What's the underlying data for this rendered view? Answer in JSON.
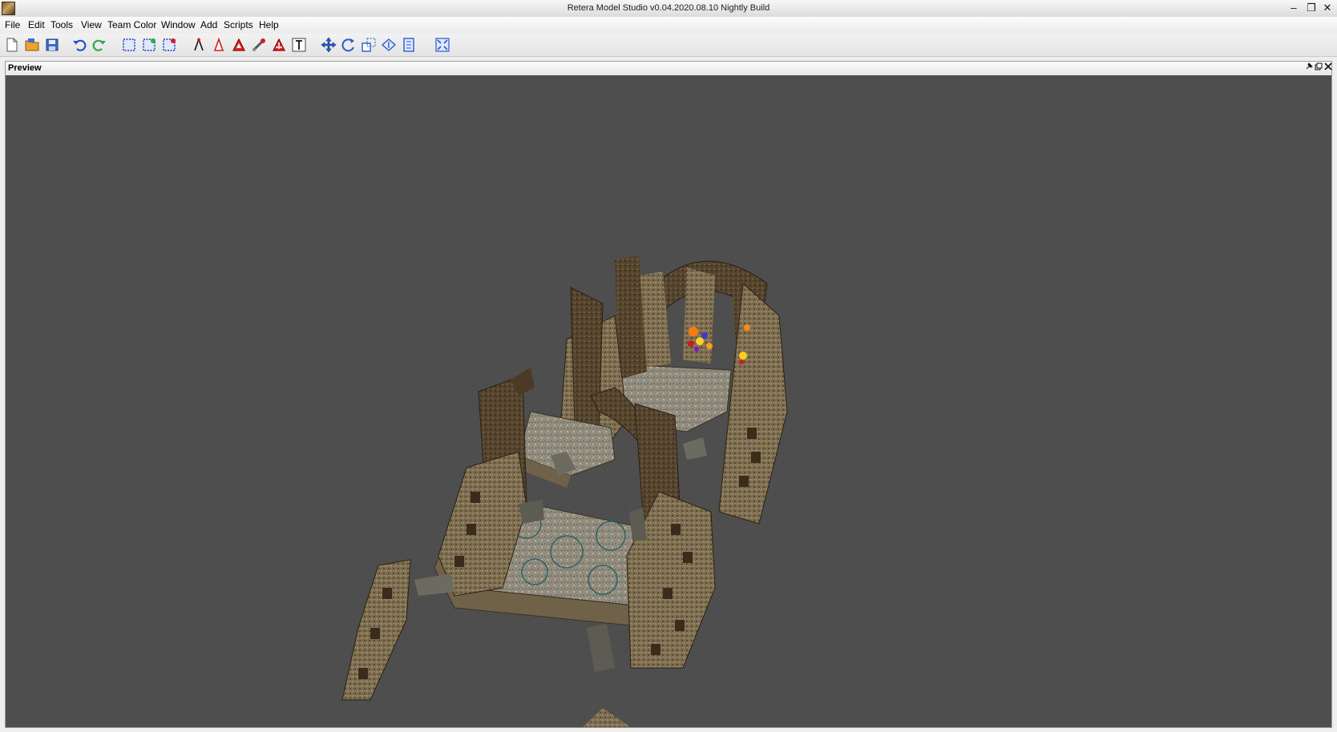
{
  "window": {
    "title": "Retera Model Studio v0.04.2020.08.10 Nightly Build",
    "minimize_glyph": "–",
    "maximize_glyph": "❐",
    "close_glyph": "✕"
  },
  "menu": [
    "File",
    "Edit",
    "Tools",
    "View",
    "Team Color",
    "Window",
    "Add",
    "Scripts",
    "Help"
  ],
  "toolbar": {
    "icons": [
      "new-file-icon",
      "open-file-icon",
      "save-icon",
      "undo-icon",
      "redo-icon",
      "select-icon",
      "add-selection-icon",
      "deselect-icon",
      "select-vertex-icon",
      "select-face-icon",
      "select-group-icon",
      "select-bone-icon",
      "select-cluster-icon",
      "text-icon",
      "move-icon",
      "rotate-icon",
      "scale-icon",
      "extrude-icon",
      "extend-icon",
      "fit-view-icon"
    ]
  },
  "panel": {
    "title": "Preview",
    "pin_glyph": "📌",
    "float_glyph": "⧉",
    "close_glyph": "✕"
  },
  "colors": {
    "viewport_bg": "#4e4e4e",
    "stone_light": "#8a7b5e",
    "stone_dark": "#4a3a26",
    "floor": "#9a9483"
  }
}
